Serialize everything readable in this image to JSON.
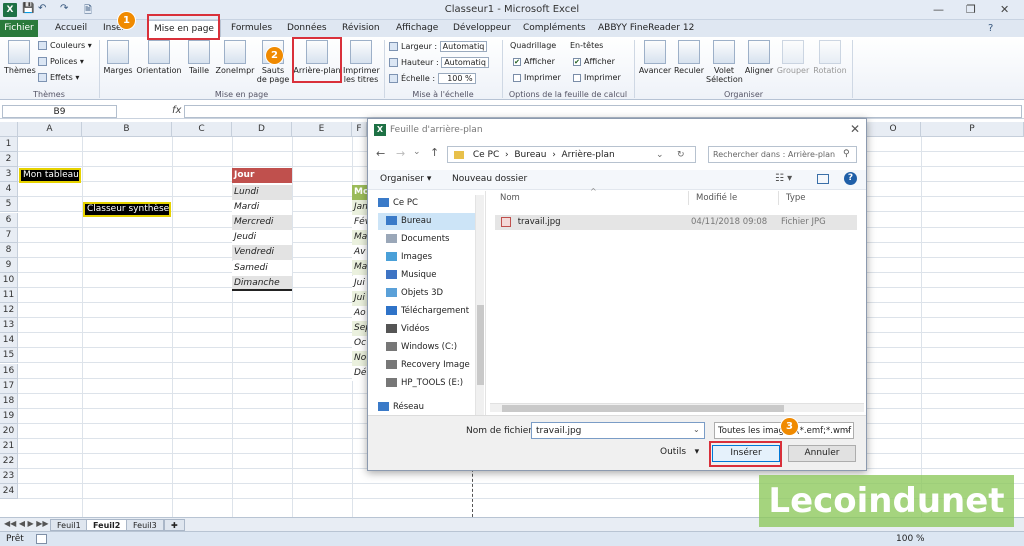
{
  "window": {
    "title": "Classeur1 - Microsoft Excel",
    "app_badge": "X",
    "controls": [
      "—",
      "❐",
      "✕"
    ]
  },
  "menu": {
    "file": "Fichier",
    "tabs": [
      "Accueil",
      "Insertion",
      "Mise en page",
      "Formules",
      "Données",
      "Révision",
      "Affichage",
      "Développeur",
      "Compléments",
      "ABBYY FineReader 12"
    ],
    "active": "Mise en page"
  },
  "ribbon": {
    "themes": {
      "big": "Thèmes",
      "couleurs": "Couleurs",
      "polices": "Polices",
      "effets": "Effets",
      "group": "Thèmes"
    },
    "page_setup": {
      "marges": "Marges",
      "orientation": "Orientation",
      "taille": "Taille",
      "zone": "ZoneImpr",
      "sauts": "Sauts de page",
      "arriere_plan": "Arrière-plan",
      "imprimer_titres": "Imprimer les titres",
      "group": "Mise en page"
    },
    "scale": {
      "largeur_label": "Largeur :",
      "largeur_val": "Automatiq",
      "hauteur_label": "Hauteur :",
      "hauteur_val": "Automatiq",
      "echelle_label": "Échelle :",
      "echelle_val": "100 %",
      "group": "Mise à l'échelle"
    },
    "sheet_opts": {
      "quadrillage": "Quadrillage",
      "entetes": "En-têtes",
      "afficher": "Afficher",
      "imprimer": "Imprimer",
      "group": "Options de la feuille de calcul"
    },
    "arrange": {
      "avancer": "Avancer",
      "reculer": "Reculer",
      "volet": "Volet Sélection",
      "aligner": "Aligner",
      "grouper": "Grouper",
      "rotation": "Rotation",
      "group": "Organiser"
    }
  },
  "formula_bar": {
    "name_box": "B9",
    "fx": "fx"
  },
  "columns": [
    "A",
    "B",
    "C",
    "D",
    "E",
    "F",
    "G",
    "H",
    "I",
    "J",
    "K",
    "L",
    "M",
    "N",
    "O",
    "P"
  ],
  "rows": [
    "1",
    "2",
    "3",
    "4",
    "5",
    "6",
    "7",
    "8",
    "9",
    "10",
    "11",
    "12",
    "13",
    "14",
    "15",
    "16",
    "17",
    "18",
    "19",
    "20",
    "21",
    "22",
    "23",
    "24"
  ],
  "cells": {
    "mon_tableau": "Mon tableau",
    "classeur_synthese": "Classeur synthèse",
    "jour": "Jour",
    "days": [
      "Lundi",
      "Mardi",
      "Mercredi",
      "Jeudi",
      "Vendredi",
      "Samedi",
      "Dimanche"
    ],
    "mois_header": "Mo",
    "months_partial": [
      "Jan",
      "Fév",
      "Ma",
      "Av",
      "Ma",
      "Jui",
      "Jui",
      "Ao",
      "Sep",
      "Oc",
      "No",
      "Dé"
    ]
  },
  "sheets": [
    "Feuil1",
    "Feuil2",
    "Feuil3"
  ],
  "active_sheet": "Feuil2",
  "status": {
    "left": "Prêt",
    "zoom": "100 %"
  },
  "dialog": {
    "title": "Feuille d'arrière-plan",
    "path": [
      "Ce PC",
      "Bureau",
      "Arrière-plan"
    ],
    "search_placeholder": "Rechercher dans : Arrière-plan",
    "organiser": "Organiser",
    "nouveau_dossier": "Nouveau dossier",
    "tree": [
      "Ce PC",
      "Bureau",
      "Documents",
      "Images",
      "Musique",
      "Objets 3D",
      "Téléchargement",
      "Vidéos",
      "Windows (C:)",
      "Recovery Image",
      "HP_TOOLS (E:)",
      "Réseau"
    ],
    "tree_selected": "Bureau",
    "columns": {
      "nom": "Nom",
      "modifie": "Modifié le",
      "type": "Type"
    },
    "files": [
      {
        "name": "travail.jpg",
        "date": "04/11/2018 09:08",
        "type": "Fichier JPG"
      }
    ],
    "filename_label": "Nom de fichier :",
    "filename_value": "travail.jpg",
    "filetype": "Toutes les images (*.emf;*.wmf",
    "outils": "Outils",
    "insert": "Insérer",
    "cancel": "Annuler"
  },
  "steps": [
    "1",
    "2",
    "3"
  ],
  "watermark": "Lecoindunet",
  "colors": {
    "accent": "#d9303a",
    "badge": "#f08a00",
    "excel_green": "#2a7a3b",
    "jour_header": "#c0504d",
    "mois_header": "#9bbb59"
  }
}
